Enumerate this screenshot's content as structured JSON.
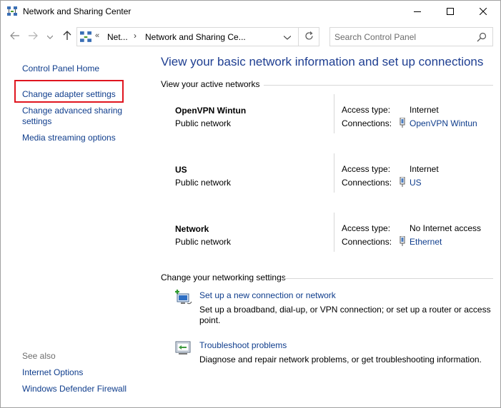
{
  "window": {
    "title": "Network and Sharing Center",
    "app_icon": "network-icon",
    "controls": {
      "minimize": "minimize-icon",
      "maximize": "maximize-icon",
      "close": "close-icon"
    }
  },
  "navigation": {
    "back_icon": "arrow-left-icon",
    "forward_icon": "arrow-right-icon",
    "recent_icon": "chevron-down-icon",
    "up_icon": "arrow-up-icon",
    "address": {
      "overflow": "«",
      "crumbs": [
        "Net...",
        "Network and Sharing Ce..."
      ],
      "separator": "›"
    },
    "refresh_icon": "refresh-icon",
    "search": {
      "placeholder": "Search Control Panel",
      "value": ""
    }
  },
  "left_pane": {
    "items": [
      {
        "label": "Control Panel Home"
      },
      {
        "label": "Change adapter settings"
      },
      {
        "label": "Change advanced sharing settings",
        "line1": "Change advanced sharing",
        "line2": "settings"
      },
      {
        "label": "Media streaming options"
      }
    ],
    "see_also_title": "See also",
    "see_also": [
      {
        "label": "Internet Options"
      },
      {
        "label": "Windows Defender Firewall"
      }
    ],
    "highlight_color": "#e0151f"
  },
  "main": {
    "heading": "View your basic network information and set up connections",
    "active_networks_title": "View your active networks",
    "access_type_label": "Access type:",
    "connections_label": "Connections:",
    "networks": [
      {
        "name": "OpenVPN Wintun",
        "category": "Public network",
        "access_type": "Internet",
        "connection": "OpenVPN Wintun"
      },
      {
        "name": "US",
        "category": "Public network",
        "access_type": "Internet",
        "connection": "US"
      },
      {
        "name": "Network",
        "category": "Public network",
        "access_type": "No Internet access",
        "connection": "Ethernet"
      }
    ],
    "settings_title": "Change your networking settings",
    "tasks": [
      {
        "icon": "new-connection-icon",
        "link": "Set up a new connection or network",
        "desc1": "Set up a broadband, dial-up, or VPN connection; or set up a router or access",
        "desc2": "point."
      },
      {
        "icon": "troubleshoot-icon",
        "link": "Troubleshoot problems",
        "desc1": "Diagnose and repair network problems, or get troubleshooting information.",
        "desc2": ""
      }
    ]
  },
  "colors": {
    "link": "#0f3d8c",
    "heading": "#1e3e91",
    "separator": "#d7d7d7"
  }
}
